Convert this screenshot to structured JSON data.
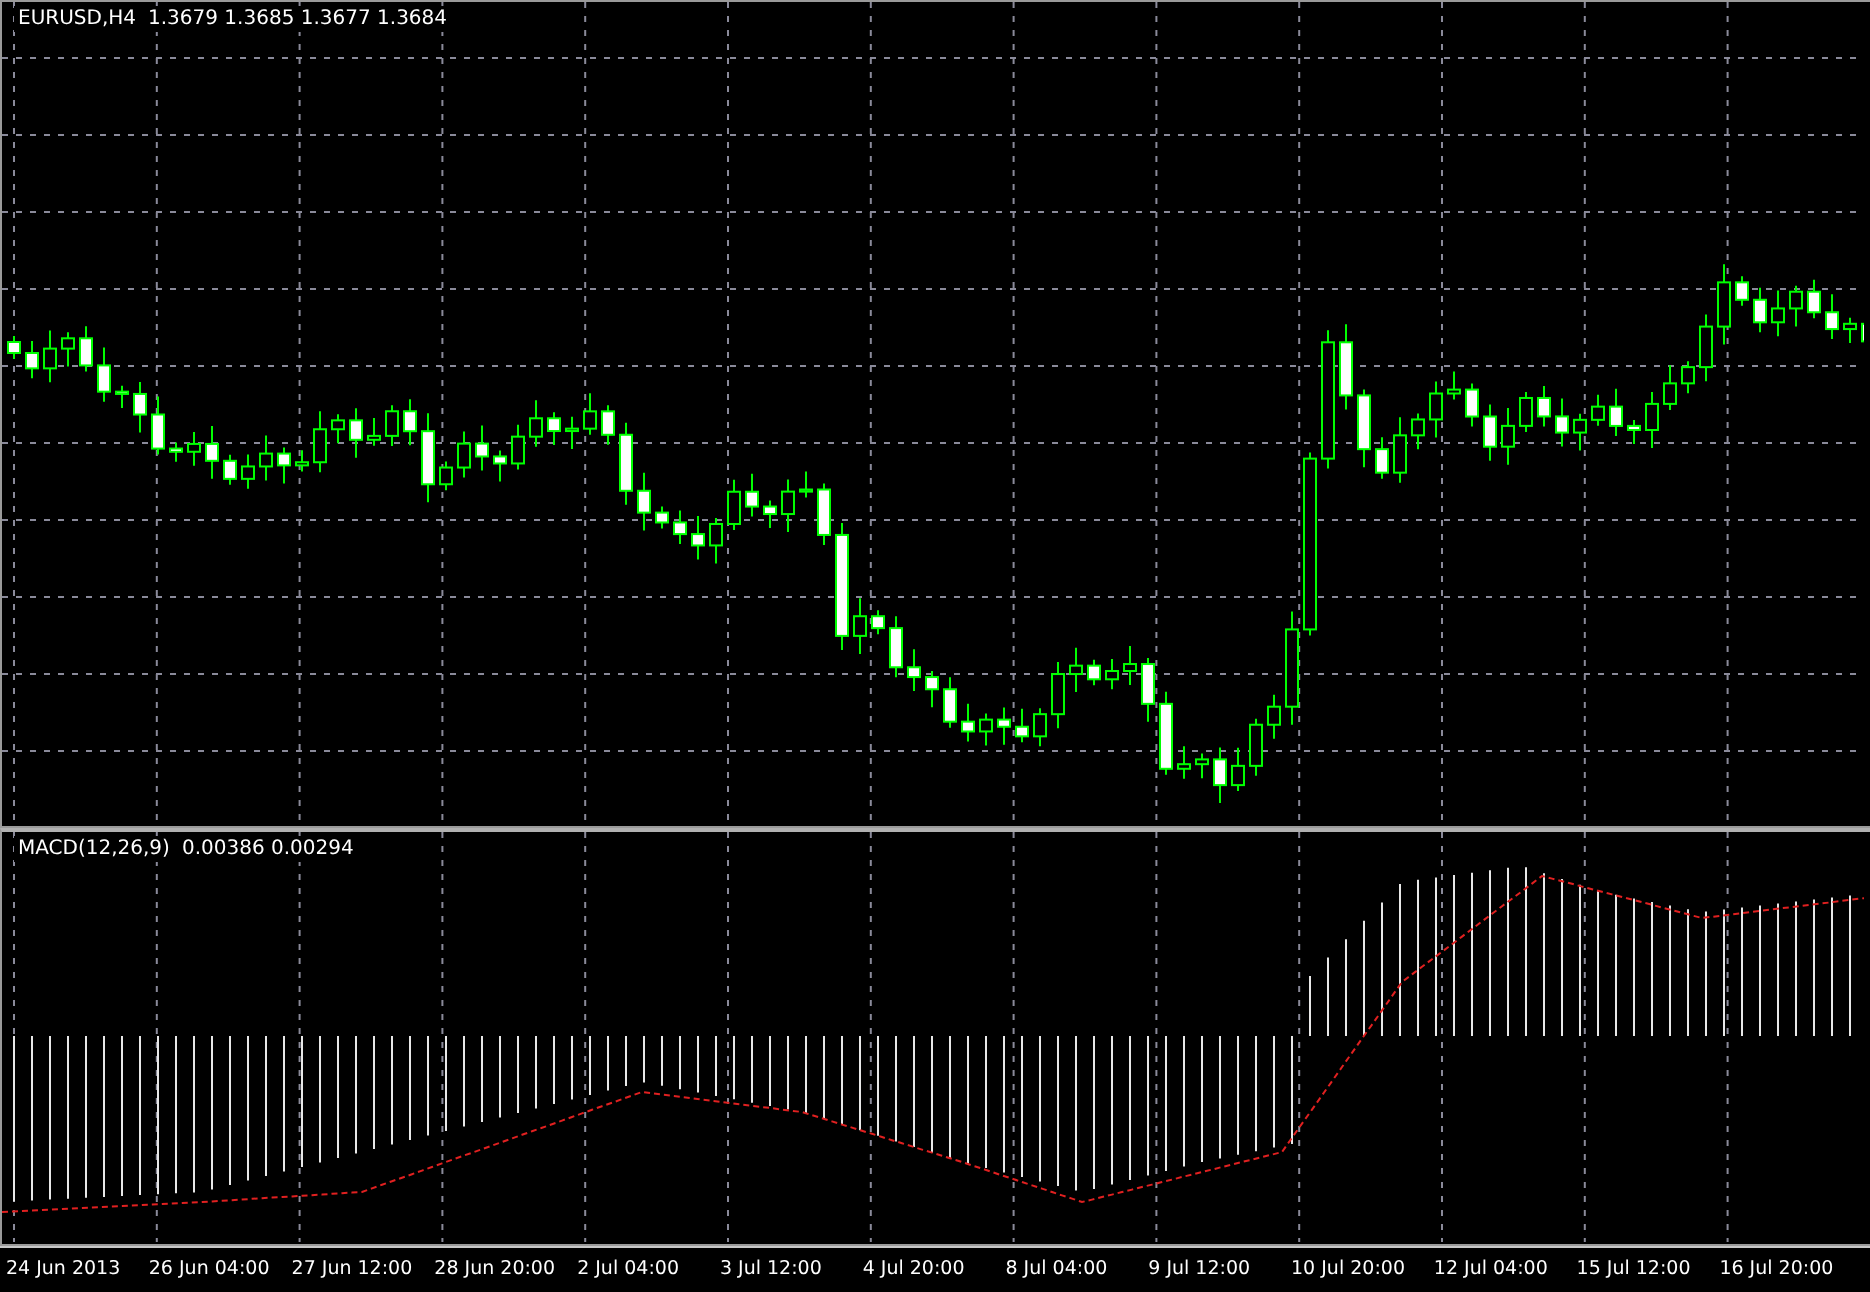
{
  "price_panel": {
    "symbol": "EURUSD,H4",
    "ohlc": "1.3679 1.3685 1.3677 1.3684"
  },
  "indicator_panel": {
    "name": "MACD(12,26,9)",
    "values": "0.00386 0.00294"
  },
  "time_axis": {
    "labels": [
      "24 Jun 2013",
      "26 Jun 04:00",
      "27 Jun 12:00",
      "28 Jun 20:00",
      "2 Jul 04:00",
      "3 Jul 12:00",
      "4 Jul 20:00",
      "8 Jul 04:00",
      "9 Jul 12:00",
      "10 Jul 20:00",
      "12 Jul 04:00",
      "15 Jul 12:00",
      "16 Jul 20:00"
    ]
  }
}
